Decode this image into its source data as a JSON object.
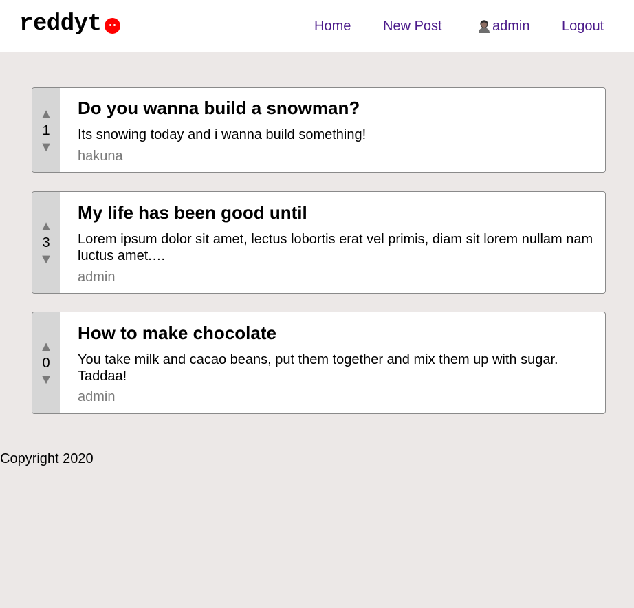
{
  "header": {
    "logo_text": "reddyt",
    "nav": {
      "home": "Home",
      "new_post": "New Post",
      "user": "admin",
      "logout": "Logout"
    }
  },
  "posts": [
    {
      "votes": "1",
      "title": "Do you wanna build a snowman?",
      "body": "Its snowing today and i wanna build something!",
      "author": "hakuna"
    },
    {
      "votes": "3",
      "title": "My life has been good until",
      "body": "Lorem ipsum dolor sit amet, lectus lobortis erat vel primis, diam sit lorem nullam nam luctus amet.…",
      "author": "admin"
    },
    {
      "votes": "0",
      "title": "How to make chocolate",
      "body": "You take milk and cacao beans, put them together and mix them up with sugar. Taddaa!",
      "author": "admin"
    }
  ],
  "vote_icons": {
    "up": "▲",
    "down": "▼"
  },
  "footer": {
    "copyright": "Copyright 2020"
  },
  "colors": {
    "background": "#ece8e7",
    "nav_link": "#4b1a8a",
    "logo_accent": "#ff0000",
    "vote_panel": "#d6d6d6",
    "muted_text": "#7a7a7a"
  }
}
